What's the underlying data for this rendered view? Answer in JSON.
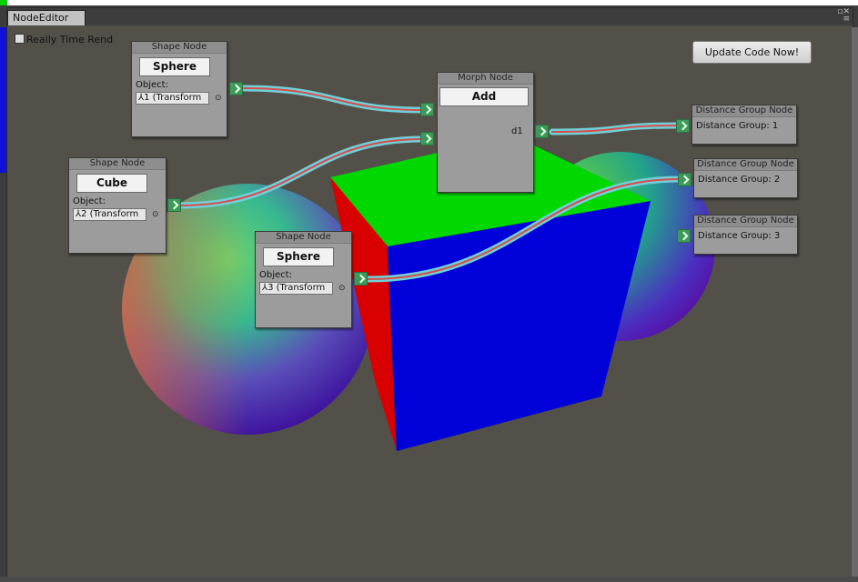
{
  "window": {
    "tab_title": "NodeEditor"
  },
  "toolbar": {
    "realtime_label": "Really Time Rend",
    "update_label": "Update Code Now!"
  },
  "shape_nodes": [
    {
      "title": "Shape Node",
      "shape": "Sphere",
      "object_label": "Object:",
      "object_value": "1 (Transform"
    },
    {
      "title": "Shape Node",
      "shape": "Cube",
      "object_label": "Object:",
      "object_value": "2 (Transform"
    },
    {
      "title": "Shape Node",
      "shape": "Sphere",
      "object_label": "Object:",
      "object_value": "3 (Transform"
    }
  ],
  "morph_node": {
    "title": "Morph Node",
    "operation": "Add",
    "output": "d1"
  },
  "distance_nodes": [
    {
      "title": "Distance Group Node",
      "label": "Distance Group: 1"
    },
    {
      "title": "Distance Group Node",
      "label": "Distance Group: 2"
    },
    {
      "title": "Distance Group Node",
      "label": "Distance Group: 3"
    }
  ],
  "colors": {
    "canvas_bg": "#535049",
    "node_bg": "#9c9c9c",
    "knob": "#3e9a5a",
    "wire_outer": "#6fd0d8",
    "wire_inner": "#d84b4b",
    "cube_top": "#00d800",
    "cube_front": "#0000d8",
    "cube_left": "#d80000"
  }
}
